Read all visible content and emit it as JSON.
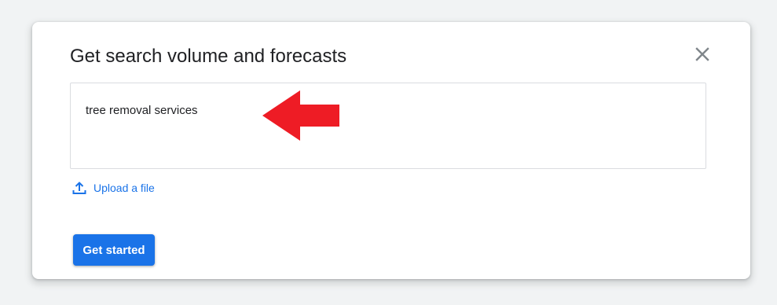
{
  "dialog": {
    "title": "Get search volume and forecasts",
    "keywords_value": "tree removal services",
    "upload_label": "Upload a file",
    "primary_button_label": "Get started"
  },
  "icons": {
    "close": "close-icon",
    "upload": "upload-icon",
    "annotation": "red-arrow-left-icon"
  },
  "colors": {
    "accent": "#1a73e8",
    "annotation": "#ee1c25",
    "background": "#f1f3f4",
    "title_text": "#202124",
    "close_icon": "#80868b"
  }
}
